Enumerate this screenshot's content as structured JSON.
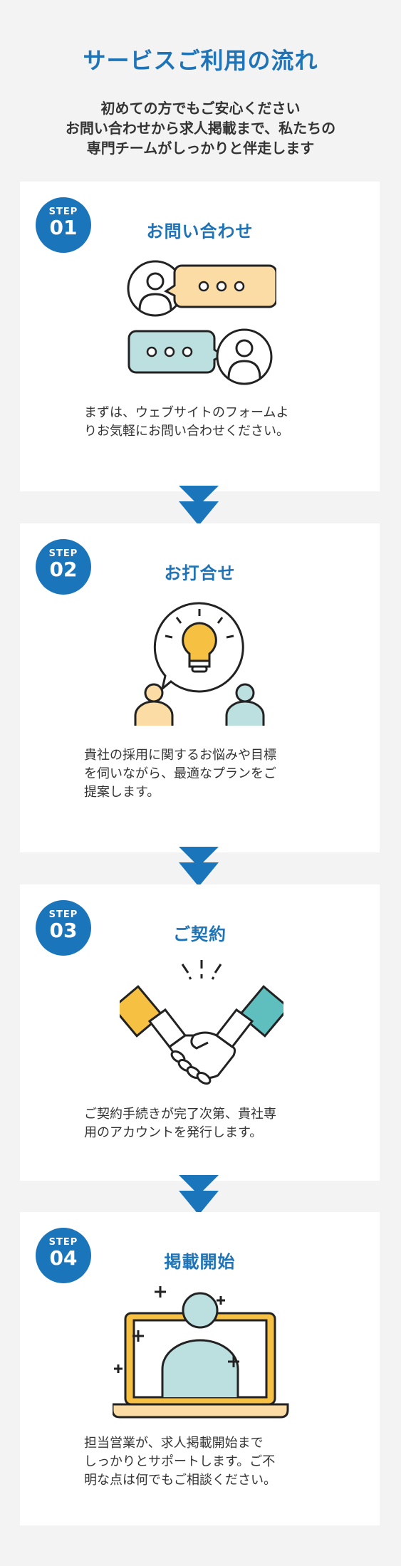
{
  "header": {
    "title": "サービスご利用の流れ",
    "intro_lines": [
      "初めての方でもご安心ください",
      "お問い合わせから求人掲載まで、私たちの",
      "専門チームがしっかりと伴走します"
    ]
  },
  "steps": [
    {
      "step_label": "STEP",
      "num": "01",
      "title": "お問い合わせ",
      "desc_lines": [
        "まずは、ウェブサイトのフォームよ",
        "りお気軽にお問い合わせください。"
      ],
      "icon": "chat-users-icon"
    },
    {
      "step_label": "STEP",
      "num": "02",
      "title": "お打合せ",
      "desc_lines": [
        "貴社の採用に関するお悩みや目標",
        "を伺いながら、最適なプランをご",
        "提案します。"
      ],
      "icon": "lightbulb-meeting-icon"
    },
    {
      "step_label": "STEP",
      "num": "03",
      "title": "ご契約",
      "desc_lines": [
        "ご契約手続きが完了次第、貴社専",
        "用のアカウントを発行します。"
      ],
      "icon": "handshake-icon"
    },
    {
      "step_label": "STEP",
      "num": "04",
      "title": "掲載開始",
      "desc_lines": [
        "担当営業が、求人掲載開始まで",
        "しっかりとサポートします。ご不",
        "明な点は何でもご相談ください。"
      ],
      "icon": "laptop-person-icon"
    }
  ],
  "colors": {
    "accent": "#1b75bb",
    "title": "#1f73b7",
    "background": "#f3f3f3",
    "yellow": "#f6c042",
    "peach": "#fbdca4",
    "teal": "#5fbfbf",
    "light_teal": "#bce0df"
  }
}
